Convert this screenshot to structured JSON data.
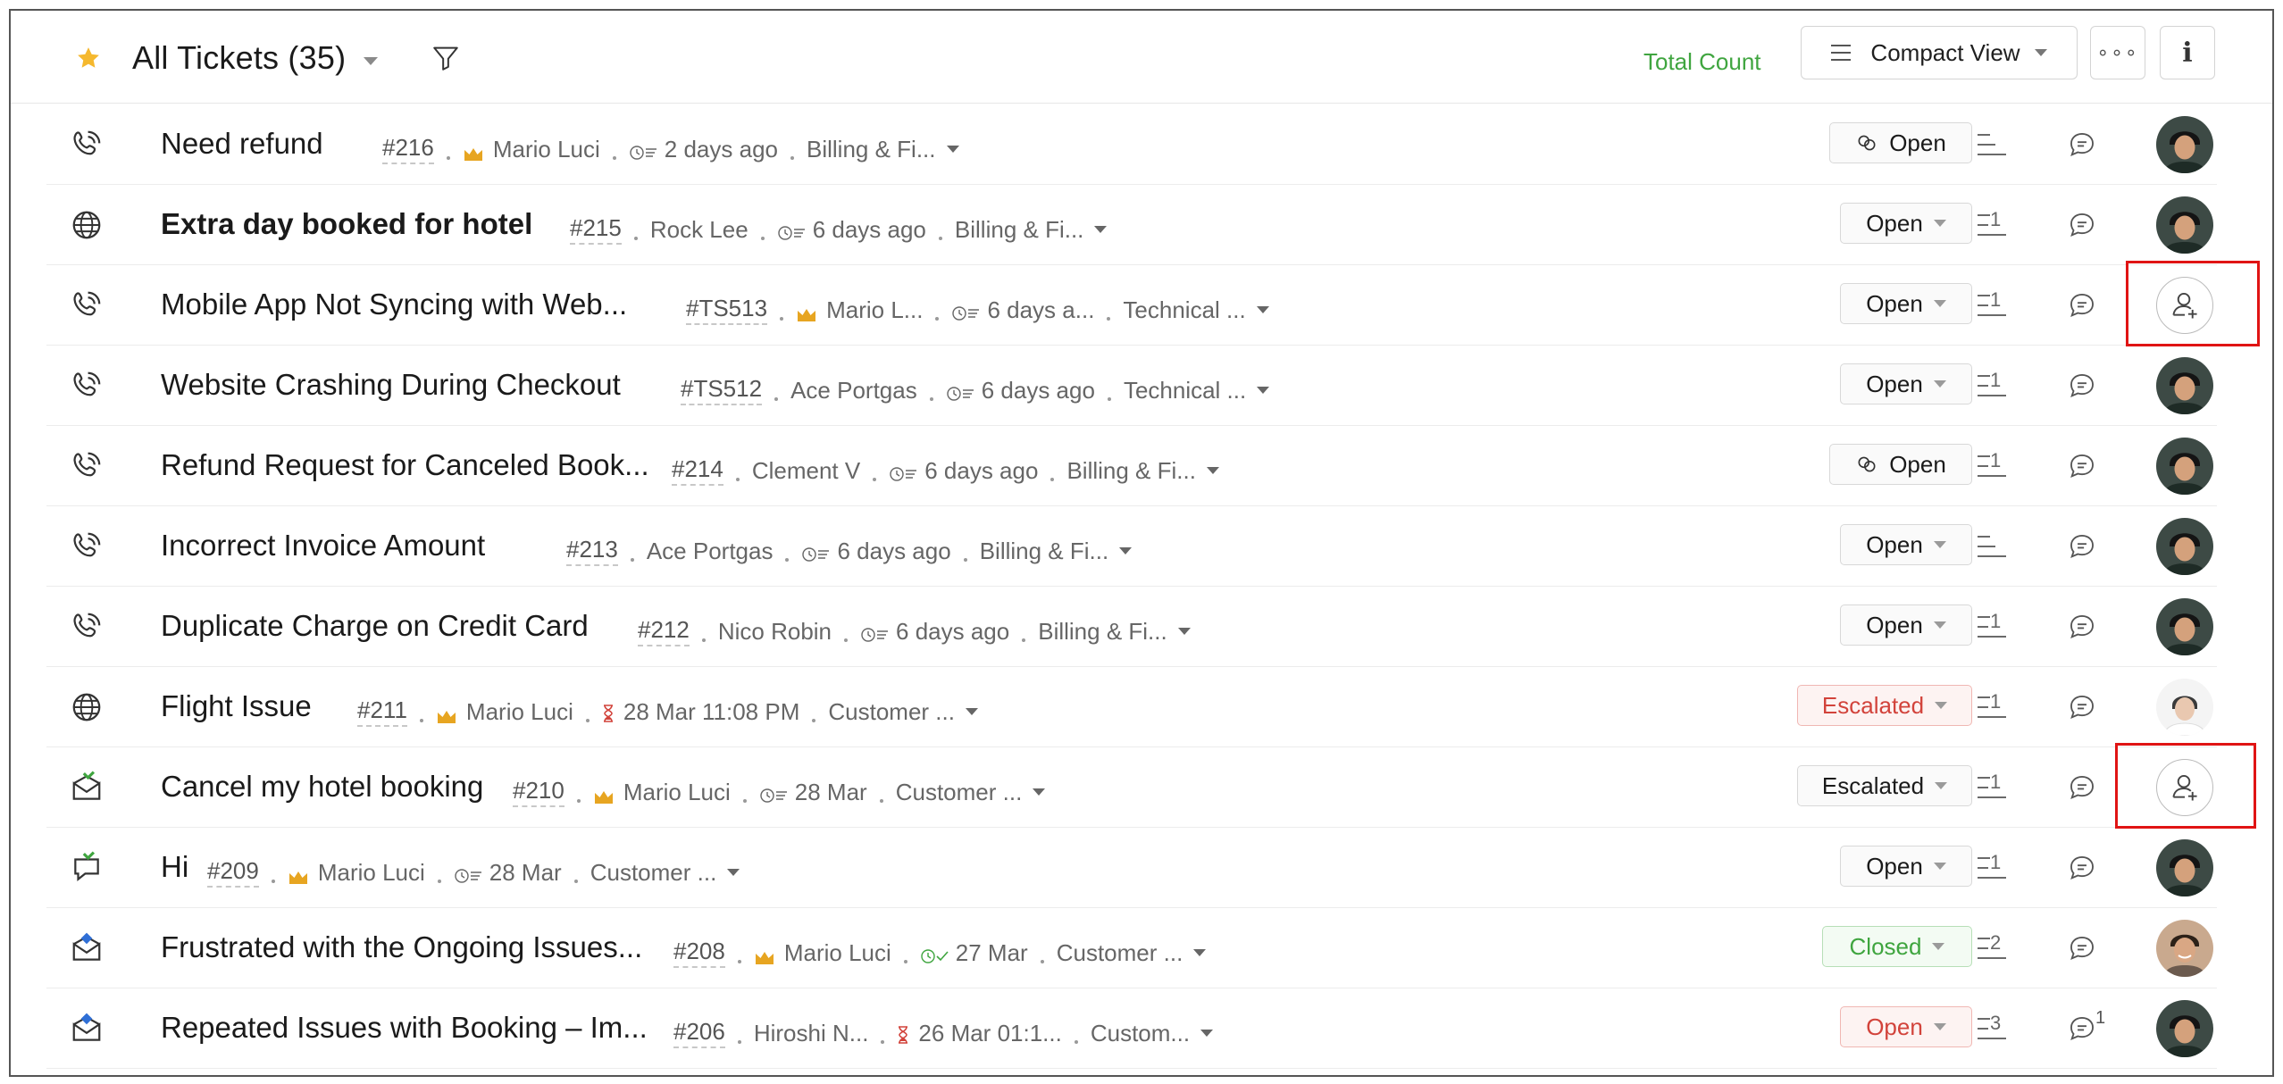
{
  "header": {
    "title": "All Tickets (35)",
    "total_count_label": "Total Count",
    "view_label": "Compact View",
    "more_label": "∘∘∘",
    "info_label": "i"
  },
  "colors": {
    "accent_green": "#3fa53f",
    "escalated_red": "#d2433b",
    "highlight_red": "#e01414",
    "star": "#f5b82e"
  },
  "tickets": [
    {
      "channel": "phone-icon",
      "subject": "Need refund",
      "bold": false,
      "number": "#216",
      "crown": true,
      "contact": "Mario Luci",
      "time_icon": "sla-clock-icon",
      "time": "2 days ago",
      "department": "Billing & Fi...",
      "status": "Open",
      "status_style": "link",
      "thread_count": "",
      "comments": "",
      "assignee": "avatar"
    },
    {
      "channel": "web-icon",
      "subject": "Extra day booked for hotel",
      "bold": true,
      "number": "#215",
      "crown": false,
      "contact": "Rock Lee",
      "time_icon": "sla-clock-icon",
      "time": "6 days ago",
      "department": "Billing & Fi...",
      "status": "Open",
      "status_style": "normal",
      "thread_count": "1",
      "comments": "",
      "assignee": "avatar"
    },
    {
      "channel": "phone-icon",
      "subject": "Mobile App Not Syncing with Web...",
      "bold": false,
      "number": "#TS513",
      "crown": true,
      "contact": "Mario L...",
      "time_icon": "sla-clock-icon",
      "time": "6 days a...",
      "department": "Technical ...",
      "status": "Open",
      "status_style": "normal",
      "thread_count": "1",
      "comments": "",
      "assignee": "unassigned"
    },
    {
      "channel": "phone-icon",
      "subject": "Website Crashing During Checkout",
      "bold": false,
      "number": "#TS512",
      "crown": false,
      "contact": "Ace Portgas",
      "time_icon": "sla-clock-icon",
      "time": "6 days ago",
      "department": "Technical ...",
      "status": "Open",
      "status_style": "normal",
      "thread_count": "1",
      "comments": "",
      "assignee": "avatar"
    },
    {
      "channel": "phone-icon",
      "subject": "Refund Request for Canceled Book...",
      "bold": false,
      "number": "#214",
      "crown": false,
      "contact": "Clement V",
      "time_icon": "sla-clock-icon",
      "time": "6 days ago",
      "department": "Billing & Fi...",
      "status": "Open",
      "status_style": "link",
      "thread_count": "1",
      "comments": "",
      "assignee": "avatar"
    },
    {
      "channel": "phone-icon",
      "subject": "Incorrect Invoice Amount",
      "bold": false,
      "number": "#213",
      "crown": false,
      "contact": "Ace Portgas",
      "time_icon": "sla-clock-icon",
      "time": "6 days ago",
      "department": "Billing & Fi...",
      "status": "Open",
      "status_style": "normal",
      "thread_count": "",
      "comments": "",
      "assignee": "avatar"
    },
    {
      "channel": "phone-icon",
      "subject": "Duplicate Charge on Credit Card",
      "bold": false,
      "number": "#212",
      "crown": false,
      "contact": "Nico Robin",
      "time_icon": "sla-clock-icon",
      "time": "6 days ago",
      "department": "Billing & Fi...",
      "status": "Open",
      "status_style": "normal",
      "thread_count": "1",
      "comments": "",
      "assignee": "avatar"
    },
    {
      "channel": "web-icon",
      "subject": "Flight Issue",
      "bold": false,
      "number": "#211",
      "crown": true,
      "contact": "Mario Luci",
      "time_icon": "overdue-hourglass-icon",
      "time": "28 Mar 11:08 PM",
      "department": "Customer ...",
      "status": "Escalated",
      "status_style": "escalated-red",
      "thread_count": "1",
      "comments": "",
      "assignee": "avatar-light"
    },
    {
      "channel": "email-icon",
      "subject": "Cancel my hotel booking",
      "bold": false,
      "number": "#210",
      "crown": true,
      "contact": "Mario Luci",
      "time_icon": "sla-clock-icon",
      "time": "28 Mar",
      "department": "Customer ...",
      "status": "Escalated",
      "status_style": "normal",
      "thread_count": "1",
      "comments": "",
      "assignee": "unassigned"
    },
    {
      "channel": "chat-icon",
      "subject": "Hi",
      "bold": false,
      "number": "#209",
      "crown": true,
      "contact": "Mario Luci",
      "time_icon": "sla-clock-icon",
      "time": "28 Mar",
      "department": "Customer ...",
      "status": "Open",
      "status_style": "normal",
      "thread_count": "1",
      "comments": "",
      "assignee": "avatar"
    },
    {
      "channel": "email-out-icon",
      "subject": "Frustrated with the Ongoing Issues...",
      "bold": false,
      "number": "#208",
      "crown": true,
      "contact": "Mario Luci",
      "time_icon": "closed-clock-icon",
      "time": "27 Mar",
      "department": "Customer ...",
      "status": "Closed",
      "status_style": "closed",
      "thread_count": "2",
      "comments": "",
      "assignee": "avatar-smile"
    },
    {
      "channel": "email-out-icon",
      "subject": "Repeated Issues with Booking – Im...",
      "bold": false,
      "number": "#206",
      "crown": false,
      "contact": "Hiroshi N...",
      "time_icon": "overdue-hourglass-icon",
      "time": "26 Mar 01:1...",
      "department": "Custom...",
      "status": "Open",
      "status_style": "open-red",
      "thread_count": "3",
      "comments": "1",
      "assignee": "avatar"
    }
  ]
}
